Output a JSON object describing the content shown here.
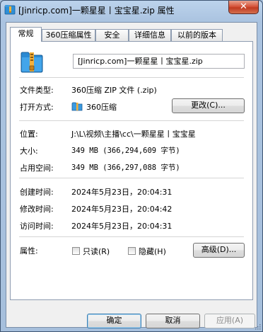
{
  "window": {
    "title": "[Jinricp.com]一颗星星丨宝宝星.zip 属性",
    "close_label": "✕"
  },
  "tabs": [
    {
      "label": "常规",
      "active": true
    },
    {
      "label": "360压缩属性",
      "active": false
    },
    {
      "label": "安全",
      "active": false
    },
    {
      "label": "详细信息",
      "active": false
    },
    {
      "label": "以前的版本",
      "active": false
    }
  ],
  "general": {
    "file_name": "[Jinricp.com]一颗星星丨宝宝星.zip",
    "file_type_label": "文件类型:",
    "file_type_value": "360压缩 ZIP 文件 (.zip)",
    "opens_with_label": "打开方式:",
    "opens_with_value": "360压缩",
    "change_button": "更改(C)...",
    "location_label": "位置:",
    "location_value": "J:\\L\\视频\\主播\\cc\\一颗星星丨宝宝星",
    "size_label": "大小:",
    "size_value": "349 MB (366,294,609 字节)",
    "size_on_disk_label": "占用空间:",
    "size_on_disk_value": "349 MB (366,297,088 字节)",
    "created_label": "创建时间:",
    "created_value": "2024年5月23日，20:04:31",
    "modified_label": "修改时间:",
    "modified_value": "2024年5月23日，20:04:42",
    "accessed_label": "访问时间:",
    "accessed_value": "2024年5月23日，20:04:31",
    "attributes_label": "属性:",
    "readonly_label": "只读(R)",
    "hidden_label": "隐藏(H)",
    "advanced_button": "高级(D)..."
  },
  "footer": {
    "ok": "确定",
    "cancel": "取消",
    "apply": "应用(A)"
  },
  "colors": {
    "accent": "#3c7fb1",
    "titlebar": "#aac3e0",
    "close": "#c13b21"
  }
}
